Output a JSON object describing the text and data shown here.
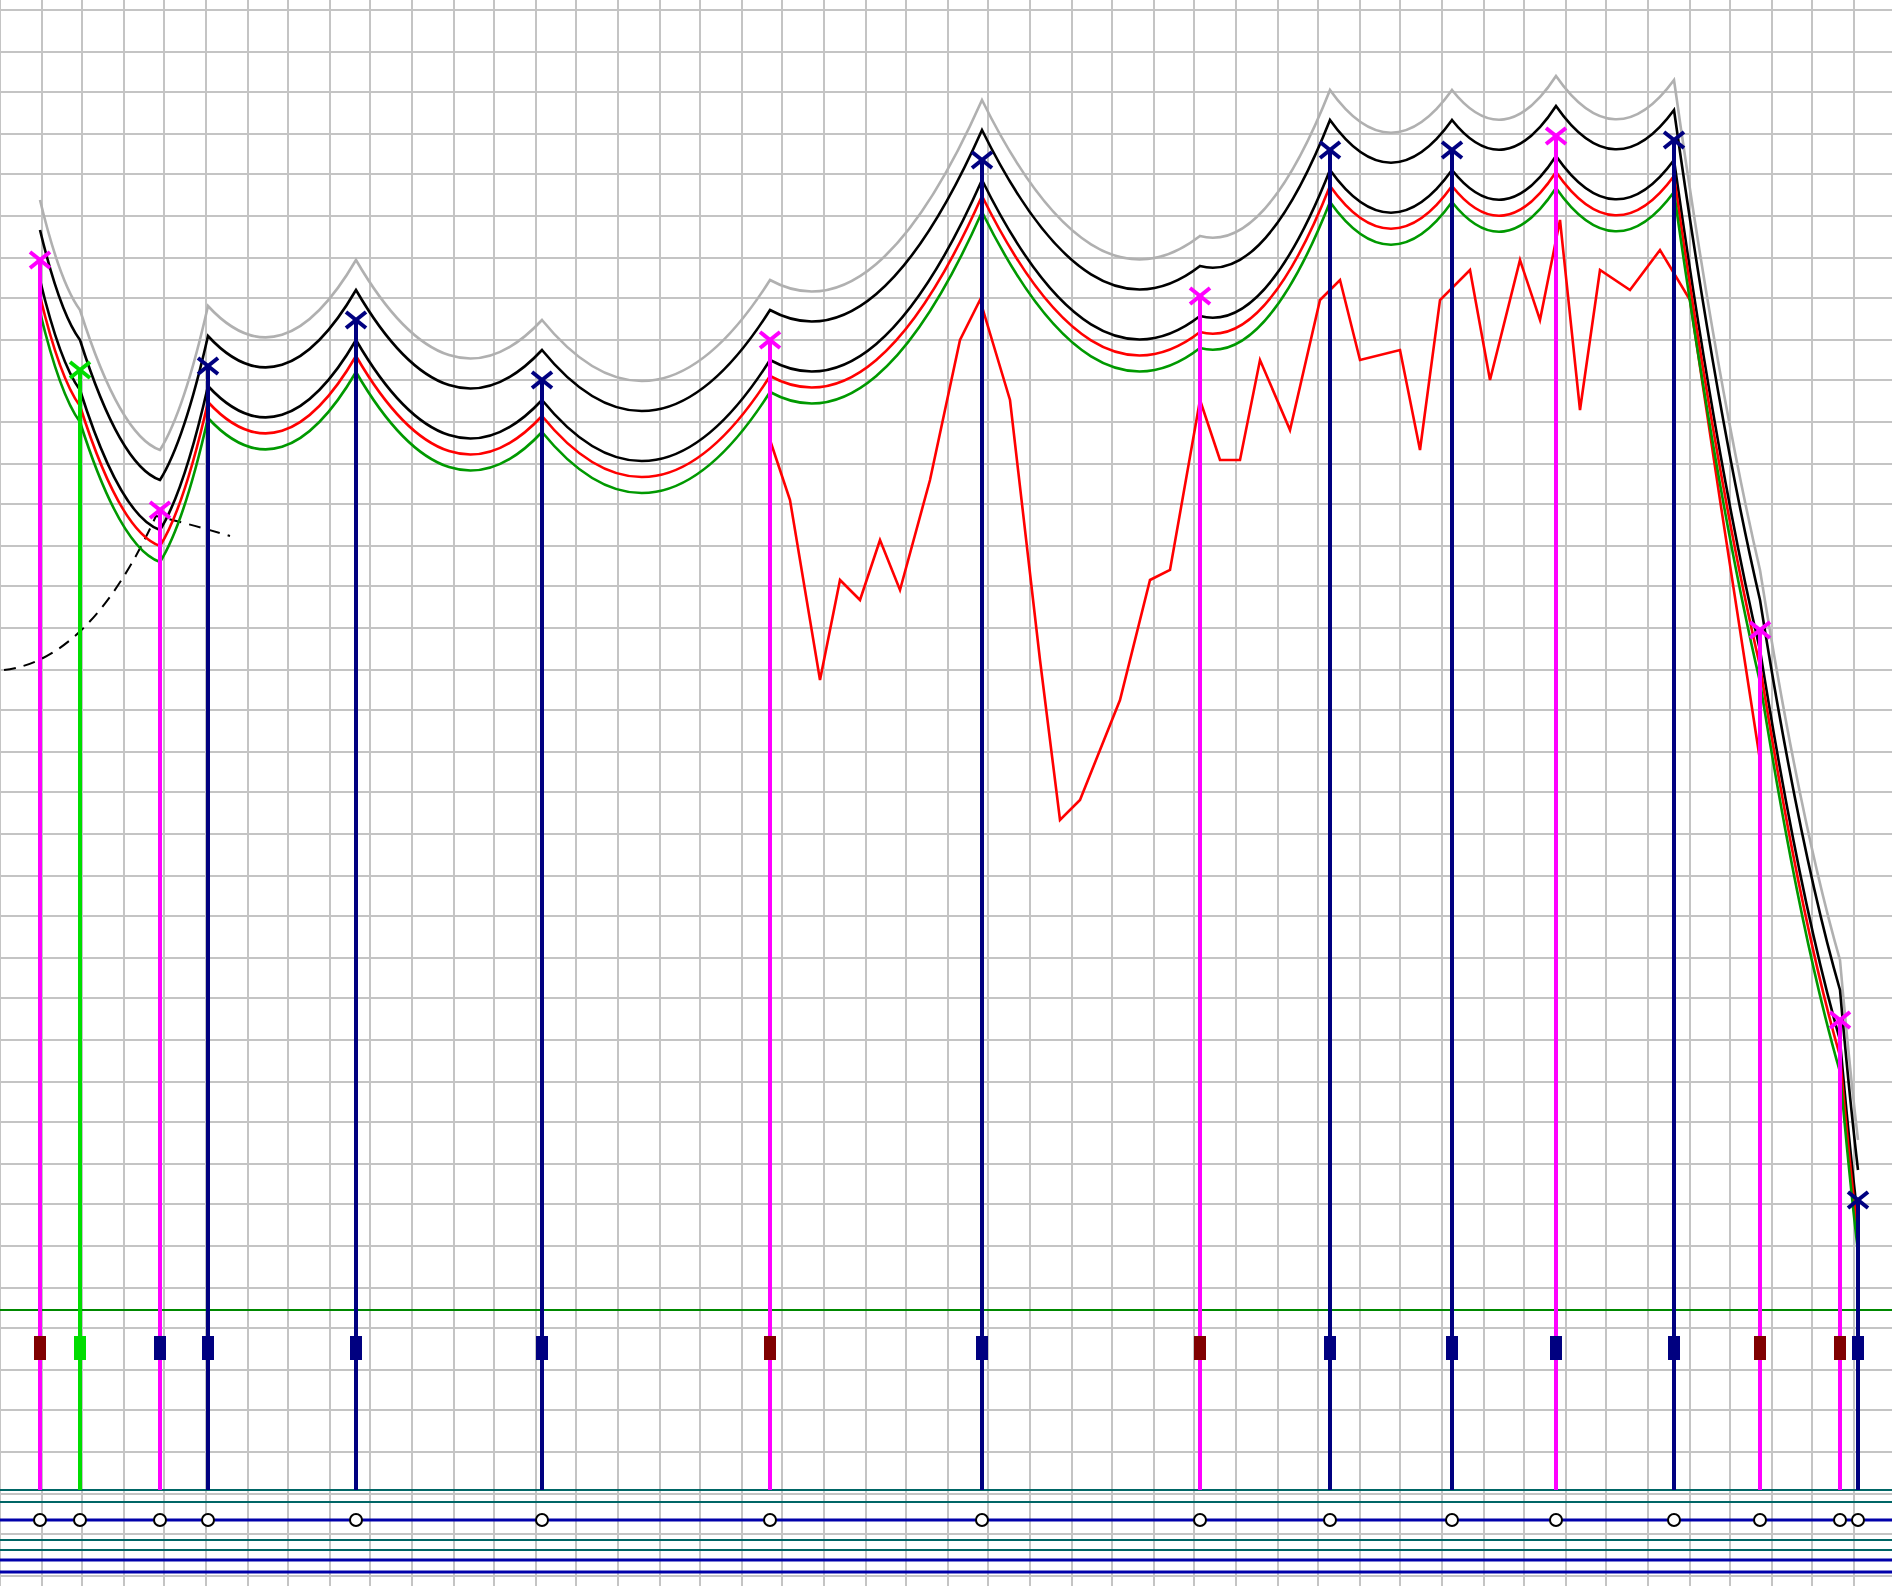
{
  "towers": [
    {
      "color": "#ff00ff",
      "marker": {
        "color": "#800000"
      }
    },
    {
      "color": "#00dd00",
      "marker": {
        "color": "#00dd00"
      }
    },
    {
      "color": "#ff00ff",
      "marker": {
        "color": "#000080"
      }
    },
    {
      "color": "#000080",
      "marker": {
        "color": "#000080"
      }
    },
    {
      "color": "#000080",
      "marker": {
        "color": "#000080"
      }
    },
    {
      "color": "#000080",
      "marker": {
        "color": "#000080"
      }
    },
    {
      "color": "#ff00ff",
      "marker": {
        "color": "#800000"
      }
    },
    {
      "color": "#000080",
      "marker": {
        "color": "#000080"
      }
    },
    {
      "color": "#ff00ff",
      "marker": {
        "color": "#800000"
      }
    },
    {
      "color": "#000080",
      "marker": {
        "color": "#000080"
      }
    },
    {
      "color": "#000080",
      "marker": {
        "color": "#000080"
      }
    },
    {
      "color": "#ff00ff",
      "marker": {
        "color": "#000080"
      }
    },
    {
      "color": "#000080",
      "marker": {
        "color": "#000080"
      }
    },
    {
      "color": "#ff00ff",
      "marker": {
        "color": "#800000"
      }
    },
    {
      "color": "#ff00ff",
      "marker": {
        "color": "#800000"
      }
    },
    {
      "color": "#000080",
      "marker": {
        "color": "#000080"
      }
    }
  ]
}
